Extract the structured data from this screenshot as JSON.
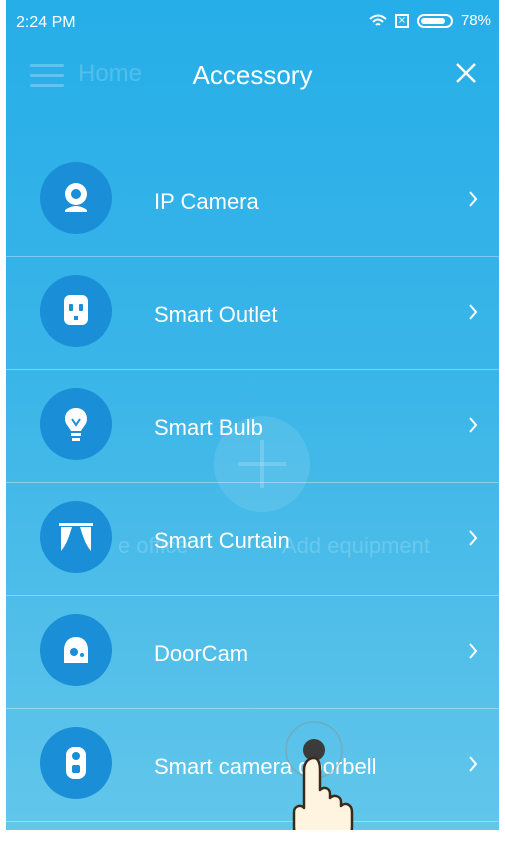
{
  "status_bar": {
    "time": "2:24 PM",
    "battery_percent": "78%",
    "icons": [
      "wifi-icon",
      "no-sim-icon",
      "battery-icon"
    ]
  },
  "header": {
    "background_title": "Home",
    "title": "Accessory",
    "close_icon": "close-icon",
    "menu_icon": "menu-icon"
  },
  "background_hint": {
    "left_text": "e office",
    "right_text": "Add equipment"
  },
  "accessories": [
    {
      "label": "IP Camera",
      "icon": "ip-camera-icon"
    },
    {
      "label": "Smart Outlet",
      "icon": "smart-outlet-icon"
    },
    {
      "label": "Smart Bulb",
      "icon": "smart-bulb-icon"
    },
    {
      "label": "Smart Curtain",
      "icon": "smart-curtain-icon"
    },
    {
      "label": "DoorCam",
      "icon": "doorcam-icon"
    },
    {
      "label": "Smart camera doorbell",
      "icon": "doorbell-icon"
    }
  ],
  "theme": {
    "primary_top": "#26aee8",
    "primary_bottom": "#62c6ea",
    "icon_circle": "#1a8fd8",
    "text": "#ffffff"
  }
}
